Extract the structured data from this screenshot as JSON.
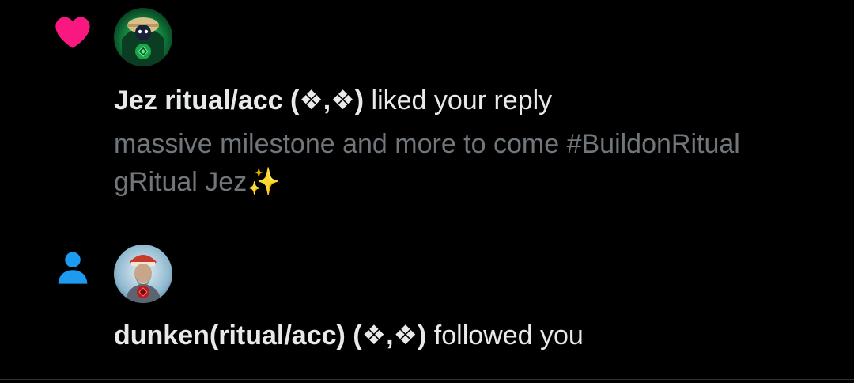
{
  "notifications": [
    {
      "type": "like",
      "type_icon": "heart-icon",
      "icon_color": "#f91880",
      "user_name": "Jez ritual/acc (❖,❖)",
      "action": "liked your reply",
      "snippet_lines": [
        "massive milestone and more to come #BuildonRitual",
        "gRitual Jez"
      ],
      "snippet_emoji": "✨"
    },
    {
      "type": "follow",
      "type_icon": "person-icon",
      "icon_color": "#1d9bf0",
      "user_name": "dunken(ritual/acc) (❖,❖)",
      "action": "followed you"
    }
  ],
  "colors": {
    "background": "#000000",
    "primary_text": "#e7e9ea",
    "secondary_text": "#71767b",
    "divider": "#2f3336"
  }
}
